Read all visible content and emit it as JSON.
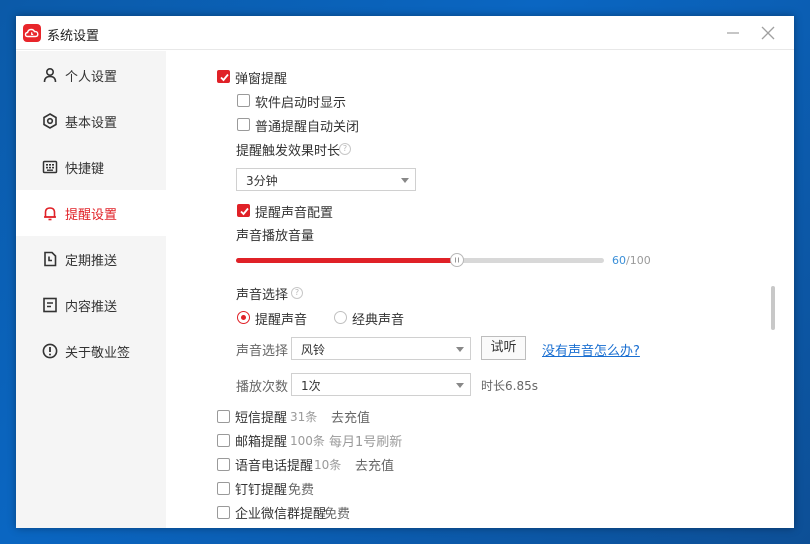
{
  "window": {
    "title": "系统设置"
  },
  "sidebar": {
    "items": [
      {
        "label": "个人设置",
        "icon": "person-icon"
      },
      {
        "label": "基本设置",
        "icon": "settings-icon"
      },
      {
        "label": "快捷键",
        "icon": "keyboard-icon"
      },
      {
        "label": "提醒设置",
        "icon": "bell-icon",
        "active": true
      },
      {
        "label": "定期推送",
        "icon": "clock-icon"
      },
      {
        "label": "内容推送",
        "icon": "document-icon"
      },
      {
        "label": "关于敬业签",
        "icon": "info-icon"
      }
    ]
  },
  "popup": {
    "label": "弹窗提醒",
    "checked": true,
    "startup_label": "软件启动时显示",
    "startup_checked": false,
    "auto_close_label": "普通提醒自动关闭",
    "auto_close_checked": false,
    "duration_label": "提醒触发效果时长",
    "duration_value": "3分钟"
  },
  "sound": {
    "config_label": "提醒声音配置",
    "config_checked": true,
    "volume_label": "声音播放音量",
    "volume_value": "60",
    "volume_max": "/100",
    "volume_fraction": 0.6,
    "choice_label": "声音选择",
    "option_reminder": "提醒声音",
    "option_classic": "经典声音",
    "select_label": "声音选择",
    "select_value": "风铃",
    "test_button": "试听",
    "no_sound_link": "没有声音怎么办?",
    "repeat_label": "播放次数",
    "repeat_value": "1次",
    "duration_text": "时长6.85s"
  },
  "channels": [
    {
      "label": "短信提醒",
      "count": "31条",
      "action": "去充值"
    },
    {
      "label": "邮箱提醒",
      "count": "100条",
      "action": "每月1号刷新"
    },
    {
      "label": "语音电话提醒",
      "count": "10条",
      "action": "去充值"
    },
    {
      "label": "钉钉提醒",
      "count": "免费",
      "action": ""
    },
    {
      "label": "企业微信群提醒",
      "count": "免费",
      "action": ""
    }
  ],
  "colors": {
    "accent": "#e02127",
    "link": "#1a6fd1",
    "volume_value": "#3a8fd8"
  }
}
